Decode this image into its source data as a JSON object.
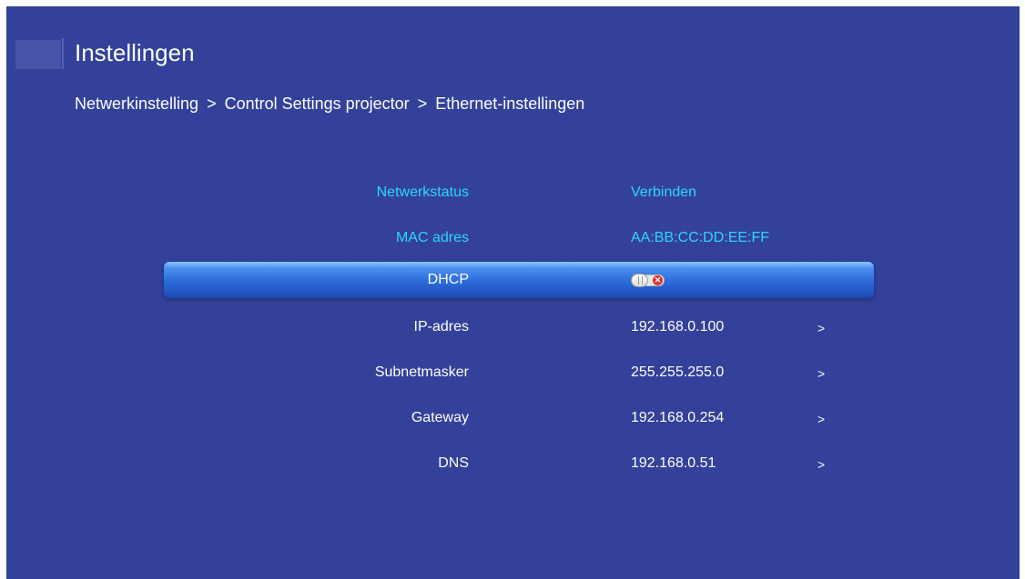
{
  "header": {
    "title": "Instellingen"
  },
  "breadcrumb": {
    "items": [
      "Netwerkinstelling",
      "Control Settings projector",
      "Ethernet-instellingen"
    ],
    "separator": ">"
  },
  "settings": {
    "network_status": {
      "label": "Netwerkstatus",
      "value": "Verbinden"
    },
    "mac_address": {
      "label": "MAC adres",
      "value": "AA:BB:CC:DD:EE:FF"
    },
    "dhcp": {
      "label": "DHCP",
      "state": "off"
    },
    "ip_address": {
      "label": "IP-adres",
      "value": "192.168.0.100",
      "arrow": ">"
    },
    "subnet_mask": {
      "label": "Subnetmasker",
      "value": "255.255.255.0",
      "arrow": ">"
    },
    "gateway": {
      "label": "Gateway",
      "value": "192.168.0.254",
      "arrow": ">"
    },
    "dns": {
      "label": "DNS",
      "value": "192.168.0.51",
      "arrow": ">"
    }
  },
  "colors": {
    "background": "#33419a",
    "info_text": "#2fd5ff",
    "highlight": "#2f6fdc",
    "toggle_off": "#e0322c"
  }
}
